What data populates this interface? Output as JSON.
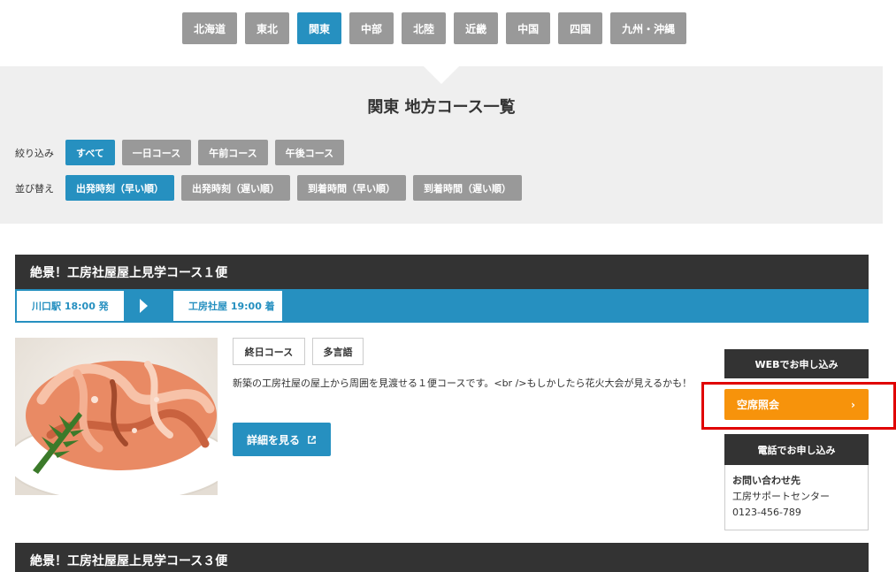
{
  "regions": [
    {
      "label": "北海道",
      "active": false
    },
    {
      "label": "東北",
      "active": false
    },
    {
      "label": "関東",
      "active": true
    },
    {
      "label": "中部",
      "active": false
    },
    {
      "label": "北陸",
      "active": false
    },
    {
      "label": "近畿",
      "active": false
    },
    {
      "label": "中国",
      "active": false
    },
    {
      "label": "四国",
      "active": false
    },
    {
      "label": "九州・沖縄",
      "active": false
    }
  ],
  "panel": {
    "title": "関東 地方コース一覧",
    "filter": {
      "label": "絞り込み",
      "options": [
        {
          "label": "すべて",
          "active": true
        },
        {
          "label": "一日コース",
          "active": false
        },
        {
          "label": "午前コース",
          "active": false
        },
        {
          "label": "午後コース",
          "active": false
        }
      ]
    },
    "sort": {
      "label": "並び替え",
      "options": [
        {
          "label": "出発時刻（早い順）",
          "active": true
        },
        {
          "label": "出発時刻（遅い順）",
          "active": false
        },
        {
          "label": "到着時間（早い順）",
          "active": false
        },
        {
          "label": "到着時間（遅い順）",
          "active": false
        }
      ]
    }
  },
  "course1": {
    "title": "絶景！工房社屋屋上見学コース１便",
    "departure": "川口駅 18:00 発",
    "arrival": "工房社屋 19:00 着",
    "tags": [
      "終日コース",
      "多言語"
    ],
    "description": "新築の工房社屋の屋上から周囲を見渡せる１便コースです。<br />もしかしたら花火大会が見えるかも！",
    "detail_button": "詳細を見る",
    "web_apply": {
      "heading": "WEBでお申し込み",
      "button": "空席照会"
    },
    "phone_apply": {
      "heading": "電話でお申し込み",
      "contact_title": "お問い合わせ先",
      "center": "工房サポートセンター",
      "phone": "0123-456-789"
    }
  },
  "course2": {
    "title": "絶景！工房社屋屋上見学コース３便"
  },
  "colors": {
    "accent_blue": "#2690c0",
    "inactive_gray": "#999999",
    "dark_header": "#333333",
    "orange_button": "#f7930b",
    "highlight_red": "#e00000"
  }
}
